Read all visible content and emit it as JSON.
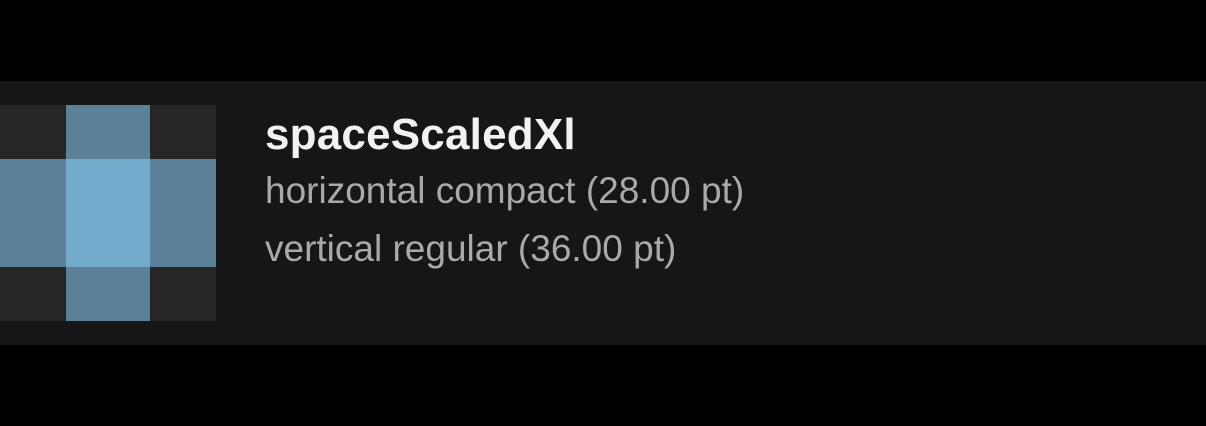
{
  "token": {
    "name": "spaceScaledXl",
    "horizontal": "horizontal compact (28.00 pt)",
    "vertical": "vertical regular (36.00 pt)"
  },
  "swatch_colors": {
    "corner": "#262626",
    "edge": "#5b8199",
    "center": "#72abcb"
  }
}
